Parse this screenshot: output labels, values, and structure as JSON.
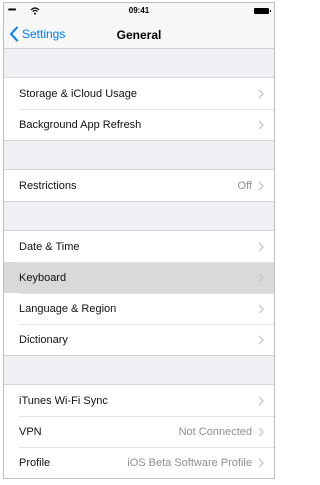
{
  "status_bar": {
    "signal": "•••••",
    "time": "09:41"
  },
  "nav": {
    "back_label": "Settings",
    "title": "General"
  },
  "groups": [
    {
      "rows": [
        {
          "label": "Storage & iCloud Usage",
          "value": ""
        },
        {
          "label": "Background App Refresh",
          "value": ""
        }
      ]
    },
    {
      "rows": [
        {
          "label": "Restrictions",
          "value": "Off"
        }
      ]
    },
    {
      "rows": [
        {
          "label": "Date & Time",
          "value": ""
        },
        {
          "label": "Keyboard",
          "value": "",
          "highlighted": true
        },
        {
          "label": "Language & Region",
          "value": ""
        },
        {
          "label": "Dictionary",
          "value": ""
        }
      ]
    },
    {
      "rows": [
        {
          "label": "iTunes Wi-Fi Sync",
          "value": ""
        },
        {
          "label": "VPN",
          "value": "Not Connected"
        },
        {
          "label": "Profile",
          "value": "iOS Beta Software Profile"
        }
      ]
    }
  ],
  "colors": {
    "accent": "#007aff",
    "highlight": "#d9d9d9",
    "background": "#efeff4"
  },
  "icons": [
    "wifi-icon",
    "battery-icon",
    "back-chevron-icon",
    "chevron-right-icon"
  ]
}
